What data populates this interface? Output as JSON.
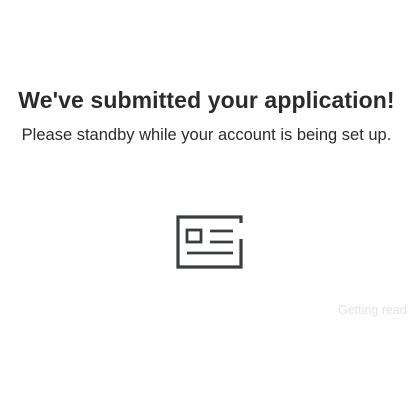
{
  "confirmation": {
    "headline": "We've submitted your application!",
    "subline": "Please standby while your account is being set up.",
    "icon": "id-card-icon",
    "status_text": "Getting read"
  },
  "colors": {
    "background": "#ffffff",
    "text": "#2b2b2b",
    "icon_stroke": "#3a3d3f",
    "faded_status": "#e3e3e3"
  }
}
